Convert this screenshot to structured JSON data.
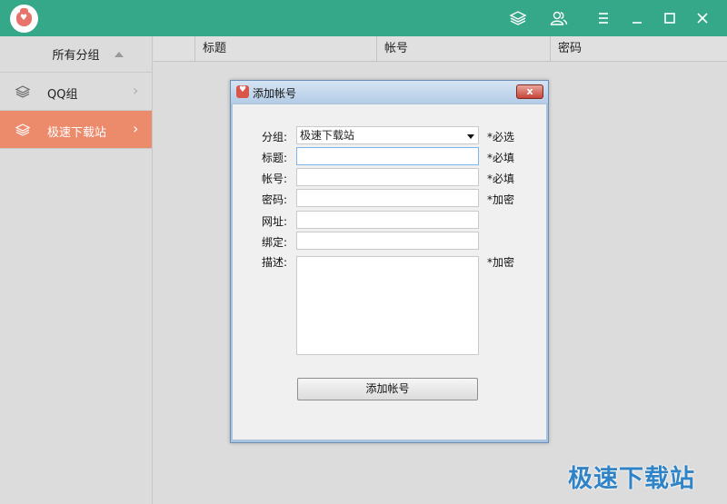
{
  "window": {
    "controls": [
      "layers-icon",
      "users-icon",
      "menu-icon",
      "minimize-icon",
      "maximize-icon",
      "close-icon"
    ]
  },
  "sidebar": {
    "header": "所有分组",
    "items": [
      {
        "label": "QQ组",
        "active": false
      },
      {
        "label": "极速下载站",
        "active": true
      }
    ]
  },
  "table": {
    "columns": [
      "",
      "标题",
      "帐号",
      "密码"
    ]
  },
  "dialog": {
    "title": "添加帐号",
    "close_label": "x",
    "fields": {
      "group": {
        "label": "分组:",
        "value": "极速下载站",
        "hint": "*必选"
      },
      "title": {
        "label": "标题:",
        "value": "",
        "hint": "*必填"
      },
      "account": {
        "label": "帐号:",
        "value": "",
        "hint": "*必填"
      },
      "password": {
        "label": "密码:",
        "value": "",
        "hint": "*加密"
      },
      "url": {
        "label": "网址:",
        "value": ""
      },
      "bind": {
        "label": "绑定:",
        "value": ""
      },
      "description": {
        "label": "描述:",
        "value": "",
        "hint": "*加密"
      }
    },
    "submit_label": "添加帐号"
  },
  "watermark": "极速下载站",
  "colors": {
    "titlebar": "#36a88a",
    "active_item": "#ec8a6c",
    "background": "#dcdcdc",
    "watermark": "#2f83c6"
  }
}
